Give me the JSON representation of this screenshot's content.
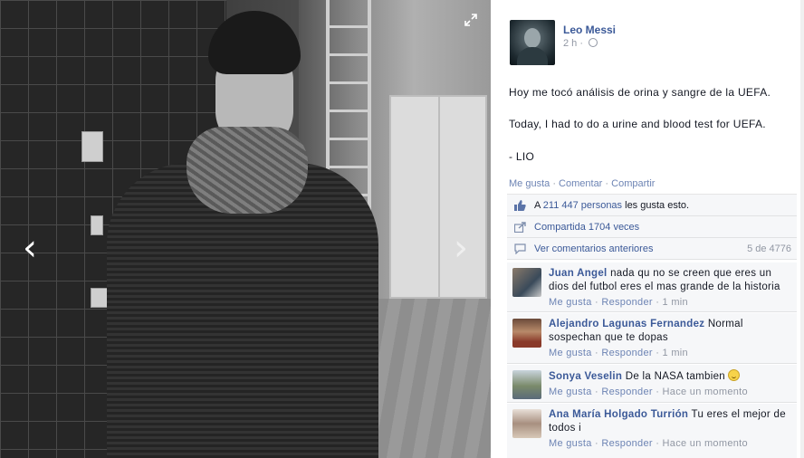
{
  "photo": {
    "prev_label": "‹",
    "next_label": "›",
    "expand_icon": "expand-icon"
  },
  "post": {
    "author": "Leo Messi",
    "time": "2 h",
    "privacy_icon": "globe-icon",
    "line1": "Hoy me tocó análisis de orina y sangre de la UEFA.",
    "line2": "Today, I had to do a urine and blood test for UEFA.",
    "line3": "- LIO"
  },
  "actions": {
    "like": "Me gusta",
    "comment": "Comentar",
    "share": "Compartir"
  },
  "ufi": {
    "likes_prefix": "A",
    "likes_link": "211 447 personas",
    "likes_suffix": "les gusta esto.",
    "shares": "Compartida 1704 veces",
    "view_previous": "Ver comentarios anteriores",
    "comment_count": "5 de 4776"
  },
  "comments": [
    {
      "name": "Juan Angel",
      "text": "nada qu no se creen que eres un dios del futbol eres el mas grande de la historia",
      "like": "Me gusta",
      "reply": "Responder",
      "time": "1 min"
    },
    {
      "name": "Alejandro Lagunas Fernandez",
      "text": "Normal sospechan que te dopas",
      "like": "Me gusta",
      "reply": "Responder",
      "time": "1 min"
    },
    {
      "name": "Sonya Veselin",
      "text": "De la NASA tambien",
      "like": "Me gusta",
      "reply": "Responder",
      "time": "Hace un momento"
    },
    {
      "name": "Ana María Holgado Turrión",
      "text": "Tu eres el mejor de todos i",
      "like": "Me gusta",
      "reply": "Responder",
      "time": "Hace un momento"
    }
  ],
  "colors": {
    "link": "#3b5998",
    "muted": "#9197a3",
    "panel": "#f6f7f9"
  }
}
